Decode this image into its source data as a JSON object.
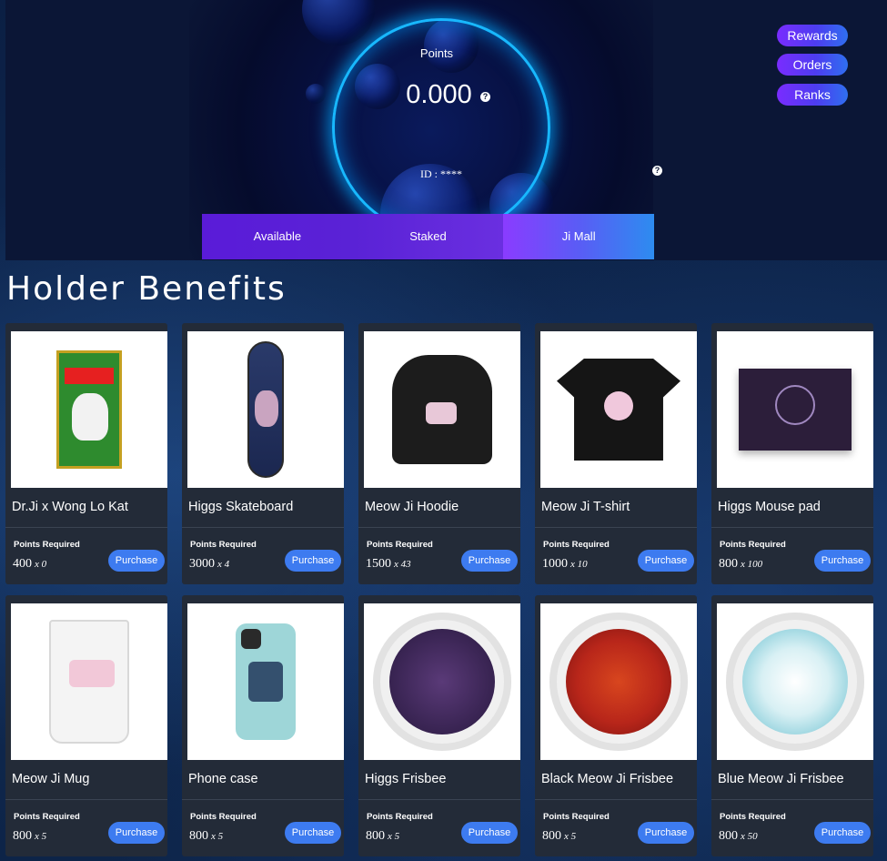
{
  "hero": {
    "points_label": "Points",
    "points_value": "0.000",
    "id_label": "ID : ****",
    "help_glyph": "?"
  },
  "side_nav": [
    {
      "label": "Rewards"
    },
    {
      "label": "Orders"
    },
    {
      "label": "Ranks"
    }
  ],
  "tabs": [
    {
      "label": "Available"
    },
    {
      "label": "Staked"
    },
    {
      "label": "Ji Mall"
    }
  ],
  "benefits": {
    "title": "Holder Benefits",
    "items": [
      {
        "name": "Dr.Ji x Wong Lo Kat",
        "req_label": "Points Required",
        "points": "400",
        "qty": "x 0",
        "button": "Purchase",
        "product": "juice"
      },
      {
        "name": "Higgs Skateboard",
        "req_label": "Points Required",
        "points": "3000",
        "qty": "x 4",
        "button": "Purchase",
        "product": "board"
      },
      {
        "name": "Meow Ji Hoodie",
        "req_label": "Points Required",
        "points": "1500",
        "qty": "x 43",
        "button": "Purchase",
        "product": "hoodie"
      },
      {
        "name": "Meow Ji T-shirt",
        "req_label": "Points Required",
        "points": "1000",
        "qty": "x 10",
        "button": "Purchase",
        "product": "tee"
      },
      {
        "name": "Higgs Mouse pad",
        "req_label": "Points Required",
        "points": "800",
        "qty": "x 100",
        "button": "Purchase",
        "product": "pad"
      },
      {
        "name": "Meow Ji Mug",
        "req_label": "Points Required",
        "points": "800",
        "qty": "x 5",
        "button": "Purchase",
        "product": "mug"
      },
      {
        "name": "Phone case",
        "req_label": "Points Required",
        "points": "800",
        "qty": "x 5",
        "button": "Purchase",
        "product": "phone"
      },
      {
        "name": "Higgs Frisbee",
        "req_label": "Points Required",
        "points": "800",
        "qty": "x 5",
        "button": "Purchase",
        "product": "frisbee-purple"
      },
      {
        "name": "Black Meow Ji Frisbee",
        "req_label": "Points Required",
        "points": "800",
        "qty": "x 5",
        "button": "Purchase",
        "product": "frisbee-red"
      },
      {
        "name": "Blue Meow Ji Frisbee",
        "req_label": "Points Required",
        "points": "800",
        "qty": "x 50",
        "button": "Purchase",
        "product": "frisbee-blue"
      }
    ]
  },
  "colors": {
    "accent_purple": "#7a2cff",
    "accent_blue": "#3d7bf0",
    "card_bg": "#232b38",
    "ring_glow": "#18b8ff"
  }
}
